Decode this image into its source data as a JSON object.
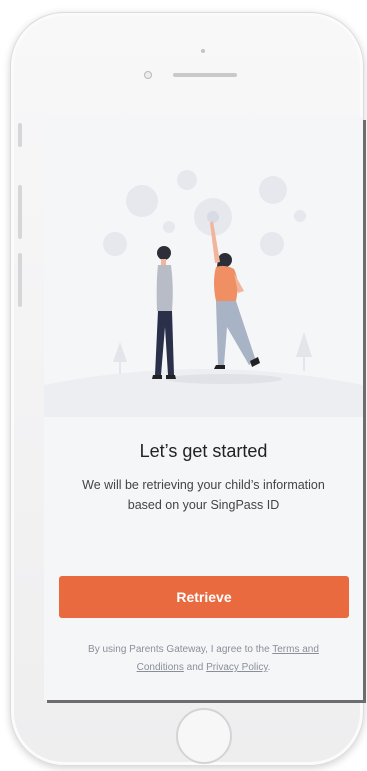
{
  "screen": {
    "title": "Let’s get started",
    "subtitle": "We will be retrieving your child’s information based on your SingPass ID",
    "primary_button_label": "Retrieve",
    "terms": {
      "prefix": "By using Parents Gateway, I agree to the",
      "terms_link": "Terms and Conditions",
      "and": "and",
      "privacy_link": "Privacy Policy",
      "suffix": "."
    }
  },
  "colors": {
    "accent": "#e86a3e",
    "background": "#f5f6f8",
    "text_primary": "#222222",
    "text_muted": "#8a8f98"
  },
  "icons": {
    "illustration": "two-people-reaching-bubbles-illustration",
    "home": "home-button"
  }
}
